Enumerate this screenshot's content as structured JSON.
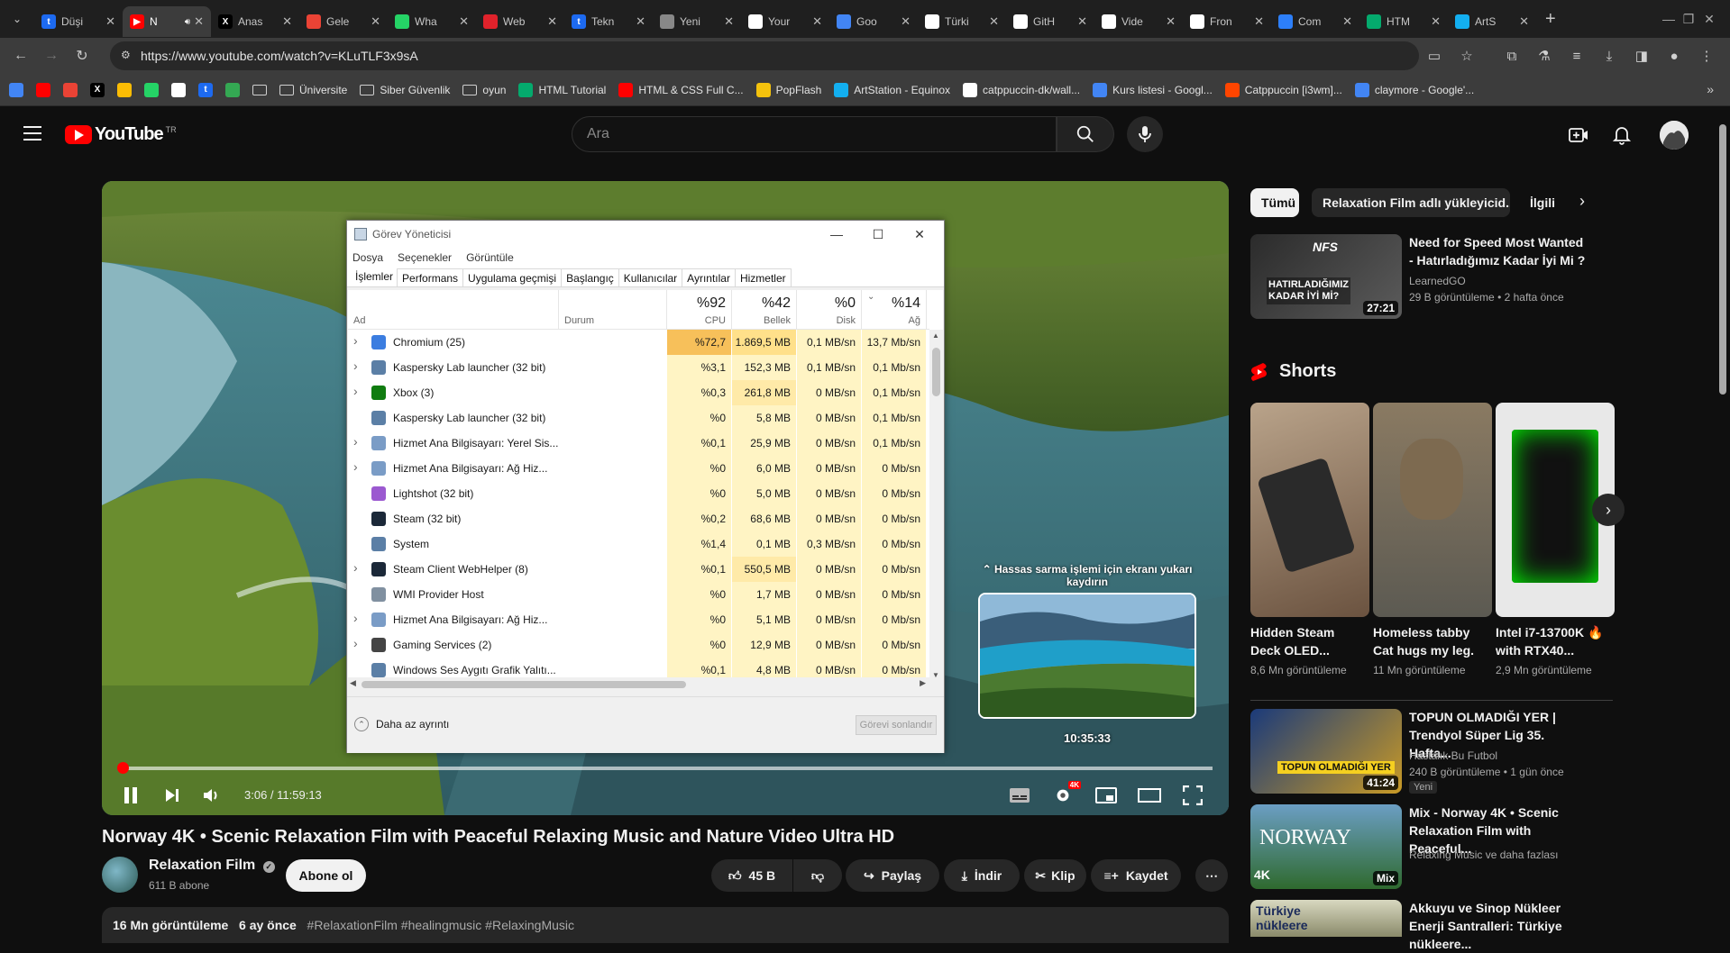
{
  "browser": {
    "tabs": [
      {
        "title": "Düşi",
        "icon": "t",
        "color": "#1d6af0"
      },
      {
        "title": "N",
        "icon": "youtube",
        "color": "#ff0000",
        "active": true
      },
      {
        "title": "Anas",
        "icon": "x",
        "color": "#000000"
      },
      {
        "title": "Gele",
        "icon": "gmail",
        "color": "#ea4335"
      },
      {
        "title": "Wha",
        "icon": "whatsapp",
        "color": "#25d366"
      },
      {
        "title": "Web",
        "icon": "opera",
        "color": "#e0222b"
      },
      {
        "title": "Tekn",
        "icon": "t",
        "color": "#1d6af0"
      },
      {
        "title": "Yeni",
        "icon": "globe",
        "color": "#888888"
      },
      {
        "title": "Your",
        "icon": "notion",
        "color": "#ffffff"
      },
      {
        "title": "Goo",
        "icon": "google",
        "color": "#4285f4"
      },
      {
        "title": "Türki",
        "icon": "medium",
        "color": "#ffffff"
      },
      {
        "title": "GitH",
        "icon": "github",
        "color": "#ffffff"
      },
      {
        "title": "Vide",
        "icon": "s",
        "color": "#ffffff"
      },
      {
        "title": "Fron",
        "icon": "f",
        "color": "#ffffff"
      },
      {
        "title": "Com",
        "icon": "terminal",
        "color": "#2d7ff9"
      },
      {
        "title": "HTM",
        "icon": "w3",
        "color": "#04aa6d"
      },
      {
        "title": "ArtS",
        "icon": "artstation",
        "color": "#13aff0"
      }
    ],
    "url": "https://www.youtube.com/watch?v=KLuTLF3x9sA",
    "bookmarks": [
      {
        "label": "",
        "icon": "google",
        "color": "#4285f4"
      },
      {
        "label": "",
        "icon": "youtube",
        "color": "#ff0000"
      },
      {
        "label": "",
        "icon": "gmail",
        "color": "#ea4335"
      },
      {
        "label": "",
        "icon": "x",
        "color": "#000000"
      },
      {
        "label": "",
        "icon": "drive",
        "color": "#fbbc04"
      },
      {
        "label": "",
        "icon": "whatsapp",
        "color": "#25d366"
      },
      {
        "label": "",
        "icon": "notion",
        "color": "#ffffff"
      },
      {
        "label": "",
        "icon": "t",
        "color": "#1d6af0"
      },
      {
        "label": "",
        "icon": "power",
        "color": "#34a853"
      },
      {
        "label": "",
        "icon": "folder",
        "color": "#cfcfcf"
      },
      {
        "label": "Üniversite",
        "icon": "folder"
      },
      {
        "label": "Siber Güvenlik",
        "icon": "folder"
      },
      {
        "label": "oyun",
        "icon": "folder"
      },
      {
        "label": "HTML Tutorial",
        "icon": "w3",
        "color": "#04aa6d"
      },
      {
        "label": "HTML & CSS Full C...",
        "icon": "youtube",
        "color": "#ff0000"
      },
      {
        "label": "PopFlash",
        "icon": "popflash",
        "color": "#f4c20d"
      },
      {
        "label": "ArtStation - Equinox",
        "icon": "artstation",
        "color": "#13aff0"
      },
      {
        "label": "catppuccin-dk/wall...",
        "icon": "github",
        "color": "#ffffff"
      },
      {
        "label": "Kurs listesi - Googl...",
        "icon": "google",
        "color": "#4285f4"
      },
      {
        "label": "Catppuccin [i3wm]...",
        "icon": "reddit",
        "color": "#ff4500"
      },
      {
        "label": "claymore - Google'...",
        "icon": "google",
        "color": "#4285f4"
      }
    ]
  },
  "youtube": {
    "logo_text": "YouTube",
    "region": "TR",
    "search_placeholder": "Ara",
    "player": {
      "time": "3:06 / 11:59:13",
      "progress_fraction": 0.0043,
      "scrub_hint": "⌃ Hassas sarma işlemi için ekranı yukarı kaydırın",
      "preview_time": "10:35:33",
      "quality_badge": "4K"
    },
    "video": {
      "title": "Norway 4K • Scenic Relaxation Film with Peaceful Relaxing Music and Nature Video Ultra HD",
      "channel": "Relaxation Film",
      "subscribers": "611 B abone",
      "subscribe_label": "Abone ol",
      "likes": "45 B",
      "share": "Paylaş",
      "download": "İndir",
      "clip": "Klip",
      "save": "Kaydet",
      "views": "16 Mn görüntüleme",
      "age": "6 ay önce",
      "hashtags": "#RelaxationFilm #healingmusic #RelaxingMusic"
    },
    "chips": [
      "Tümü",
      "Relaxation Film adlı yükleyicid...",
      "İlgili"
    ],
    "related": [
      {
        "title": "Need for Speed Most Wanted - Hatırladığımız Kadar İyi Mi ?",
        "channel": "LearnedGO",
        "meta": "29 B görüntüleme • 2 hafta önce",
        "duration": "27:21"
      },
      {
        "title": "TOPUN OLMADIĞI YER | Trendyol Süper Lig 35. Hafta...",
        "channel": "Hastalık Bu Futbol",
        "meta": "240 B görüntüleme • 1 gün önce",
        "badge": "Yeni",
        "duration": "41:24"
      },
      {
        "title": "Mix - Norway 4K • Scenic Relaxation Film with Peaceful...",
        "channel": "Relaxing Music ve daha fazlası",
        "meta": "",
        "duration": "Mix"
      },
      {
        "title": "Akkuyu ve Sinop Nükleer Enerji Santralleri: Türkiye nükleere...",
        "channel": "",
        "meta": ""
      }
    ],
    "shorts_label": "Shorts",
    "shorts": [
      {
        "title": "Hidden Steam Deck OLED...",
        "views": "8,6 Mn görüntüleme"
      },
      {
        "title": "Homeless tabby Cat hugs my leg.",
        "views": "11 Mn görüntüleme"
      },
      {
        "title": "Intel i7-13700K 🔥 with RTX40...",
        "views": "2,9 Mn görüntüleme"
      }
    ]
  },
  "taskmgr": {
    "title": "Görev Yöneticisi",
    "menu": [
      "Dosya",
      "Seçenekler",
      "Görüntüle"
    ],
    "tabs": [
      "İşlemler",
      "Performans",
      "Uygulama geçmişi",
      "Başlangıç",
      "Kullanıcılar",
      "Ayrıntılar",
      "Hizmetler"
    ],
    "columns": {
      "name": "Ad",
      "status": "Durum",
      "cpu_pct": "%92",
      "cpu": "CPU",
      "mem_pct": "%42",
      "mem": "Bellek",
      "disk_pct": "%0",
      "disk": "Disk",
      "net_pct": "%14",
      "net": "Ağ"
    },
    "rows": [
      {
        "name": "Chromium (25)",
        "cpu": "%72,7",
        "mem": "1.869,5 MB",
        "disk": "0,1 MB/sn",
        "net": "13,7 Mb/sn",
        "exp": true,
        "icon": "#3b7de0"
      },
      {
        "name": "Kaspersky Lab launcher (32 bit)",
        "cpu": "%3,1",
        "mem": "152,3 MB",
        "disk": "0,1 MB/sn",
        "net": "0,1 Mb/sn",
        "exp": true,
        "icon": "#5b7fa6"
      },
      {
        "name": "Xbox (3)",
        "cpu": "%0,3",
        "mem": "261,8 MB",
        "disk": "0 MB/sn",
        "net": "0,1 Mb/sn",
        "exp": true,
        "icon": "#107c10"
      },
      {
        "name": "Kaspersky Lab launcher (32 bit)",
        "cpu": "%0",
        "mem": "5,8 MB",
        "disk": "0 MB/sn",
        "net": "0,1 Mb/sn",
        "exp": false,
        "icon": "#5b7fa6"
      },
      {
        "name": "Hizmet Ana Bilgisayarı: Yerel Sis...",
        "cpu": "%0,1",
        "mem": "25,9 MB",
        "disk": "0 MB/sn",
        "net": "0,1 Mb/sn",
        "exp": true,
        "icon": "#7a9cc6"
      },
      {
        "name": "Hizmet Ana Bilgisayarı: Ağ Hiz...",
        "cpu": "%0",
        "mem": "6,0 MB",
        "disk": "0 MB/sn",
        "net": "0 Mb/sn",
        "exp": true,
        "icon": "#7a9cc6"
      },
      {
        "name": "Lightshot (32 bit)",
        "cpu": "%0",
        "mem": "5,0 MB",
        "disk": "0 MB/sn",
        "net": "0 Mb/sn",
        "exp": false,
        "icon": "#9b59d0"
      },
      {
        "name": "Steam (32 bit)",
        "cpu": "%0,2",
        "mem": "68,6 MB",
        "disk": "0 MB/sn",
        "net": "0 Mb/sn",
        "exp": false,
        "icon": "#1b2838"
      },
      {
        "name": "System",
        "cpu": "%1,4",
        "mem": "0,1 MB",
        "disk": "0,3 MB/sn",
        "net": "0 Mb/sn",
        "exp": false,
        "icon": "#5b7fa6"
      },
      {
        "name": "Steam Client WebHelper (8)",
        "cpu": "%0,1",
        "mem": "550,5 MB",
        "disk": "0 MB/sn",
        "net": "0 Mb/sn",
        "exp": true,
        "icon": "#1b2838"
      },
      {
        "name": "WMI Provider Host",
        "cpu": "%0",
        "mem": "1,7 MB",
        "disk": "0 MB/sn",
        "net": "0 Mb/sn",
        "exp": false,
        "icon": "#8090a0"
      },
      {
        "name": "Hizmet Ana Bilgisayarı: Ağ Hiz...",
        "cpu": "%0",
        "mem": "5,1 MB",
        "disk": "0 MB/sn",
        "net": "0 Mb/sn",
        "exp": true,
        "icon": "#7a9cc6"
      },
      {
        "name": "Gaming Services (2)",
        "cpu": "%0",
        "mem": "12,9 MB",
        "disk": "0 MB/sn",
        "net": "0 Mb/sn",
        "exp": true,
        "icon": "#444444"
      },
      {
        "name": "Windows Ses Aygıtı Grafik Yalıtı...",
        "cpu": "%0,1",
        "mem": "4,8 MB",
        "disk": "0 MB/sn",
        "net": "0 Mb/sn",
        "exp": false,
        "icon": "#5b7fa6"
      }
    ],
    "less_details": "Daha az ayrıntı",
    "end_task": "Görevi sonlandır"
  }
}
